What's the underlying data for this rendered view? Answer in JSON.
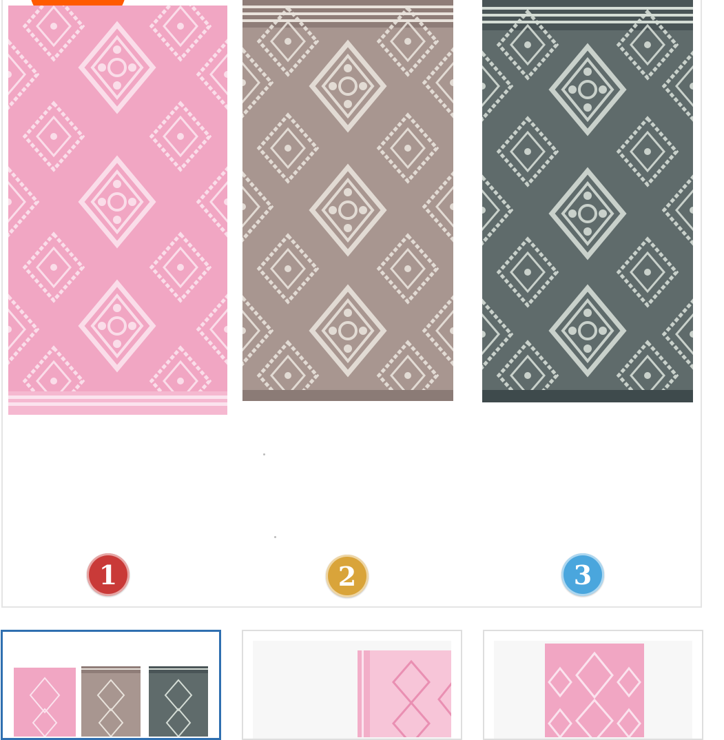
{
  "product_gallery": {
    "main_image": {
      "towels": [
        {
          "color_name": "pink",
          "fill": "#f1a6c3",
          "pattern": "#fbe3ee",
          "stripe": "#fbe3ee"
        },
        {
          "color_name": "taupe",
          "fill": "#a89690",
          "pattern": "#e9e3dc",
          "stripe": "#8b7b76"
        },
        {
          "color_name": "slate",
          "fill": "#5f6b6b",
          "pattern": "#d5ddd6",
          "stripe": "#3e4a4c"
        }
      ],
      "number_badges": [
        "1",
        "2",
        "3"
      ]
    },
    "thumbnails": [
      {
        "label": "all-colors",
        "selected": true
      },
      {
        "label": "pink-folded",
        "selected": false
      },
      {
        "label": "pink-flat",
        "selected": false
      }
    ]
  },
  "colors": {
    "accent_orange": "#ff5a00",
    "selected_border": "#2f6fb0",
    "badge_red": "#c93a38",
    "badge_gold": "#d9a43a",
    "badge_blue": "#4aa6dd"
  }
}
